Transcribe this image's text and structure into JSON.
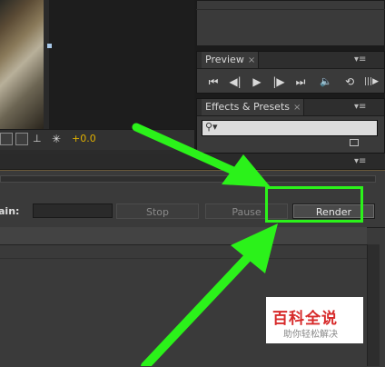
{
  "viewer": {
    "exposure_value": "+0.0"
  },
  "panels": {
    "preview": {
      "tab_label": "Preview",
      "close": "×",
      "menu": "▾≡"
    },
    "effects": {
      "tab_label": "Effects & Presets",
      "close": "×",
      "menu": "▾≡",
      "search_placeholder": ""
    }
  },
  "preview_controls": [
    "⏮",
    "◀|",
    "▶",
    "|▶",
    "⏭",
    "🔈",
    "⟲",
    "|||▶"
  ],
  "render_queue": {
    "menu": "▾≡",
    "main_label": "ain:",
    "stop_label": "Stop",
    "pause_label": "Pause",
    "render_label": "Render"
  },
  "watermark": {
    "title": "百科全说",
    "subtitle": "助你轻松解决"
  },
  "colors": {
    "highlight": "#2bf21a",
    "arrow": "#2bf21a",
    "exposure": "#e0b000"
  }
}
